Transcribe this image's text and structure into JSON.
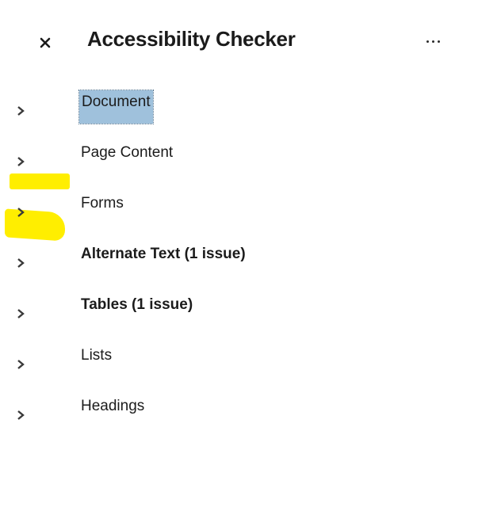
{
  "panel": {
    "title": "Accessibility Checker",
    "close_icon": "close-icon",
    "more_icon": "more-options-icon"
  },
  "rules": [
    {
      "label": "Document",
      "expanded": false,
      "focused": true,
      "bold": false
    },
    {
      "label": "Page Content",
      "expanded": false,
      "focused": false,
      "bold": false
    },
    {
      "label": "Forms",
      "expanded": false,
      "focused": false,
      "bold": false
    },
    {
      "label": "Alternate Text (1 issue)",
      "expanded": false,
      "focused": false,
      "bold": true,
      "highlighted": true
    },
    {
      "label": "Tables (1 issue)",
      "expanded": false,
      "focused": false,
      "bold": true,
      "highlighted": true
    },
    {
      "label": "Lists",
      "expanded": false,
      "focused": false,
      "bold": false
    },
    {
      "label": "Headings",
      "expanded": false,
      "focused": false,
      "bold": false
    }
  ],
  "colors": {
    "focus_background": "#9fc1dc",
    "highlighter": "#ffee00",
    "text": "#1b1b1b"
  }
}
